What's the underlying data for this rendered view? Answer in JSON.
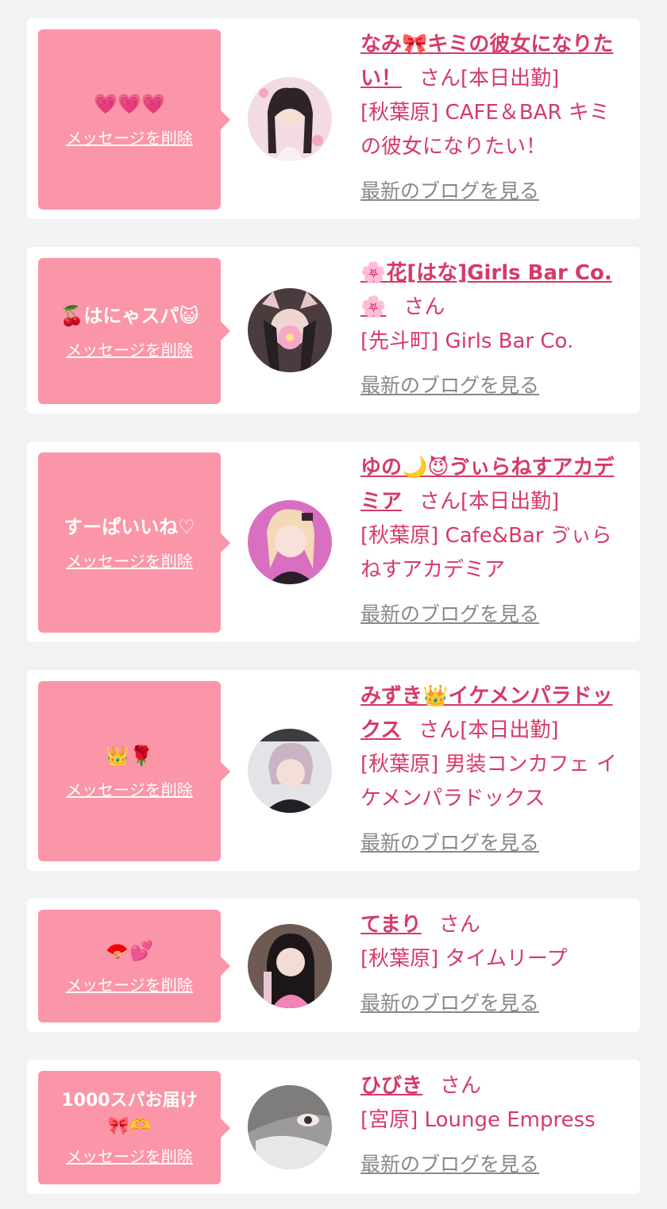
{
  "accent_colors": {
    "bubble": "#fb95a8",
    "name_link": "#d63a67",
    "blog_link": "#888888",
    "page_bg": "#f2f2f2"
  },
  "messages": [
    {
      "message": "💗💗💗",
      "delete_label": "メッセージを削除",
      "cast_name": "なみ🎀キミの彼女になりたい！",
      "honorific": "さん",
      "status": "[本日出勤]",
      "shop": "[秋葉原] CAFE＆BAR キミの彼女になりたい！",
      "blog_link": "最新のブログを見る",
      "avatar_icon": "avatar-photo"
    },
    {
      "message": "🍒はにゃスパ😺",
      "delete_label": "メッセージを削除",
      "cast_name": "🌸花[はな]Girls Bar Co.🌸",
      "honorific": "さん",
      "status": "",
      "shop": "[先斗町] Girls Bar Co.",
      "blog_link": "最新のブログを見る",
      "avatar_icon": "avatar-photo"
    },
    {
      "message": "すーぱいいね♡",
      "delete_label": "メッセージを削除",
      "cast_name": "ゆの🌙😈ゔぃらねすアカデミア",
      "honorific": "さん",
      "status": "[本日出勤]",
      "shop": "[秋葉原] Cafe&Bar ゔぃらねすアカデミア",
      "blog_link": "最新のブログを見る",
      "avatar_icon": "avatar-photo"
    },
    {
      "message": "👑🌹",
      "delete_label": "メッセージを削除",
      "cast_name": "みずき👑イケメンパラドックス",
      "honorific": "さん",
      "status": "[本日出勤]",
      "shop": "[秋葉原] 男装コンカフェ イケメンパラドックス",
      "blog_link": "最新のブログを見る",
      "avatar_icon": "avatar-photo"
    },
    {
      "message": "🪭💕",
      "delete_label": "メッセージを削除",
      "cast_name": "てまり",
      "honorific": "さん",
      "status": "",
      "shop": "[秋葉原] タイムリープ",
      "blog_link": "最新のブログを見る",
      "avatar_icon": "avatar-photo"
    },
    {
      "message": "1000スパお届け🎀🫶",
      "delete_label": "メッセージを削除",
      "cast_name": "ひびき",
      "honorific": "さん",
      "status": "",
      "shop": "[宮原] Lounge Empress",
      "blog_link": "最新のブログを見る",
      "avatar_icon": "avatar-photo"
    }
  ]
}
